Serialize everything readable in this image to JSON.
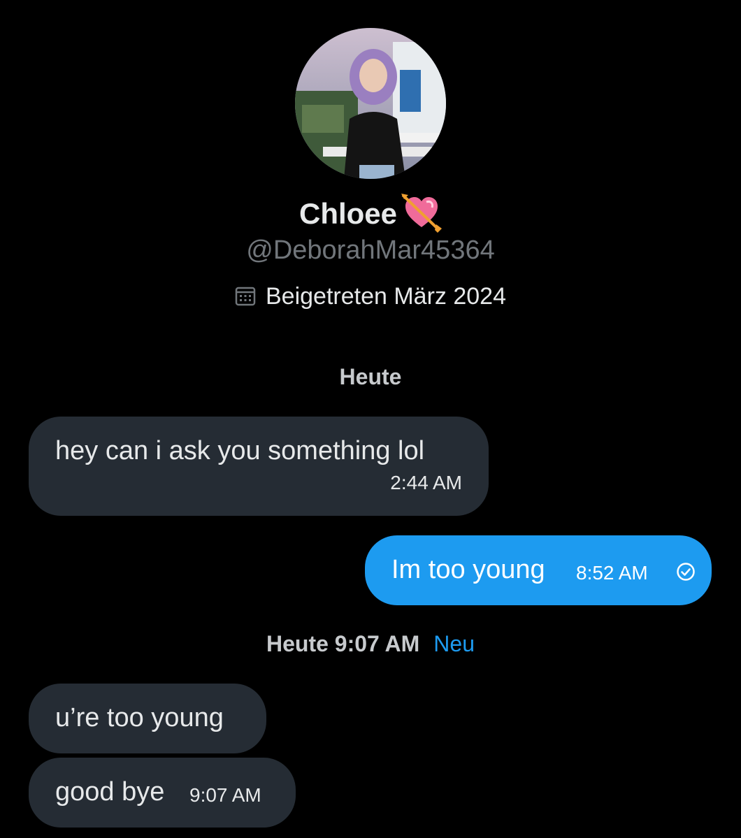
{
  "profile": {
    "avatar_alt": "profile photo",
    "display_name": "Chloee",
    "name_emoji_icon": "heart-with-arrow-icon",
    "handle": "@DeborahMar45364",
    "joined_icon": "calendar-icon",
    "joined_text": "Beigetreten März 2024"
  },
  "conversation": {
    "day_label": "Heute",
    "messages": [
      {
        "direction": "incoming",
        "text": "hey can i ask you something lol",
        "time": "2:44 AM"
      },
      {
        "direction": "outgoing",
        "text": "Im too young",
        "time": "8:52 AM",
        "status_icon": "check-circle-icon"
      },
      {
        "direction": "incoming",
        "text": "u’re too young",
        "time": ""
      },
      {
        "direction": "incoming",
        "text": "good bye",
        "time": "9:07 AM"
      }
    ],
    "divider": {
      "time_label": "Heute 9:07 AM",
      "new_label": "Neu"
    }
  },
  "colors": {
    "background": "#000000",
    "incoming_bubble": "#252c34",
    "outgoing_bubble": "#1d9bf0",
    "accent": "#1d9bf0",
    "muted_text": "#71767b",
    "primary_text": "#e7e9ea"
  }
}
